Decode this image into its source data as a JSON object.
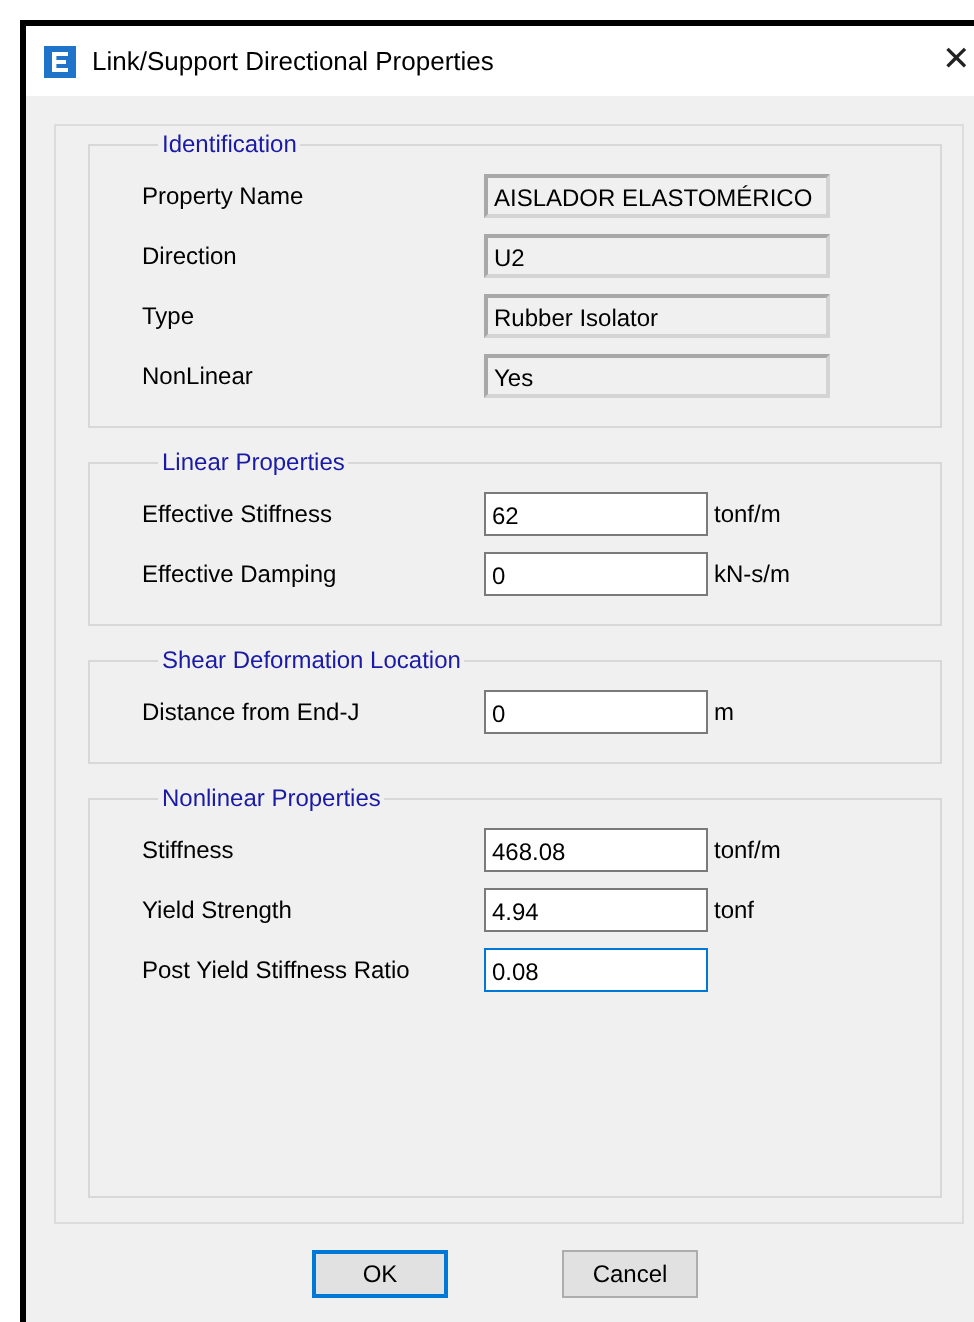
{
  "window": {
    "title": "Link/Support Directional Properties",
    "close": "✕"
  },
  "groups": [
    {
      "title": "Identification",
      "fields": [
        {
          "label": "Property Name",
          "value": "AISLADOR ELASTOMÉRICO",
          "readonly": true,
          "focused": false
        },
        {
          "label": "Direction",
          "value": "U2",
          "readonly": true,
          "focused": false
        },
        {
          "label": "Type",
          "value": "Rubber Isolator",
          "readonly": true,
          "focused": false
        },
        {
          "label": "NonLinear",
          "value": "Yes",
          "readonly": true,
          "focused": false
        }
      ]
    },
    {
      "title": "Linear Properties",
      "fields": [
        {
          "label": "Effective Stiffness",
          "value": "62",
          "unit": "tonf/m",
          "readonly": false,
          "focused": false
        },
        {
          "label": "Effective Damping",
          "value": "0",
          "unit": "kN-s/m",
          "readonly": false,
          "focused": false
        }
      ]
    },
    {
      "title": "Shear Deformation Location",
      "fields": [
        {
          "label": "Distance from End-J",
          "value": "0",
          "unit": "m",
          "readonly": false,
          "focused": false
        }
      ]
    },
    {
      "title": "Nonlinear Properties",
      "fields": [
        {
          "label": "Stiffness",
          "value": "468.08",
          "unit": "tonf/m",
          "readonly": false,
          "focused": false
        },
        {
          "label": "Yield Strength",
          "value": "4.94",
          "unit": "tonf",
          "readonly": false,
          "focused": false
        },
        {
          "label": "Post Yield Stiffness Ratio",
          "value": "0.08",
          "readonly": false,
          "focused": true
        }
      ]
    }
  ],
  "buttons": [
    {
      "label": "OK",
      "default": true
    },
    {
      "label": "Cancel",
      "default": false
    }
  ]
}
